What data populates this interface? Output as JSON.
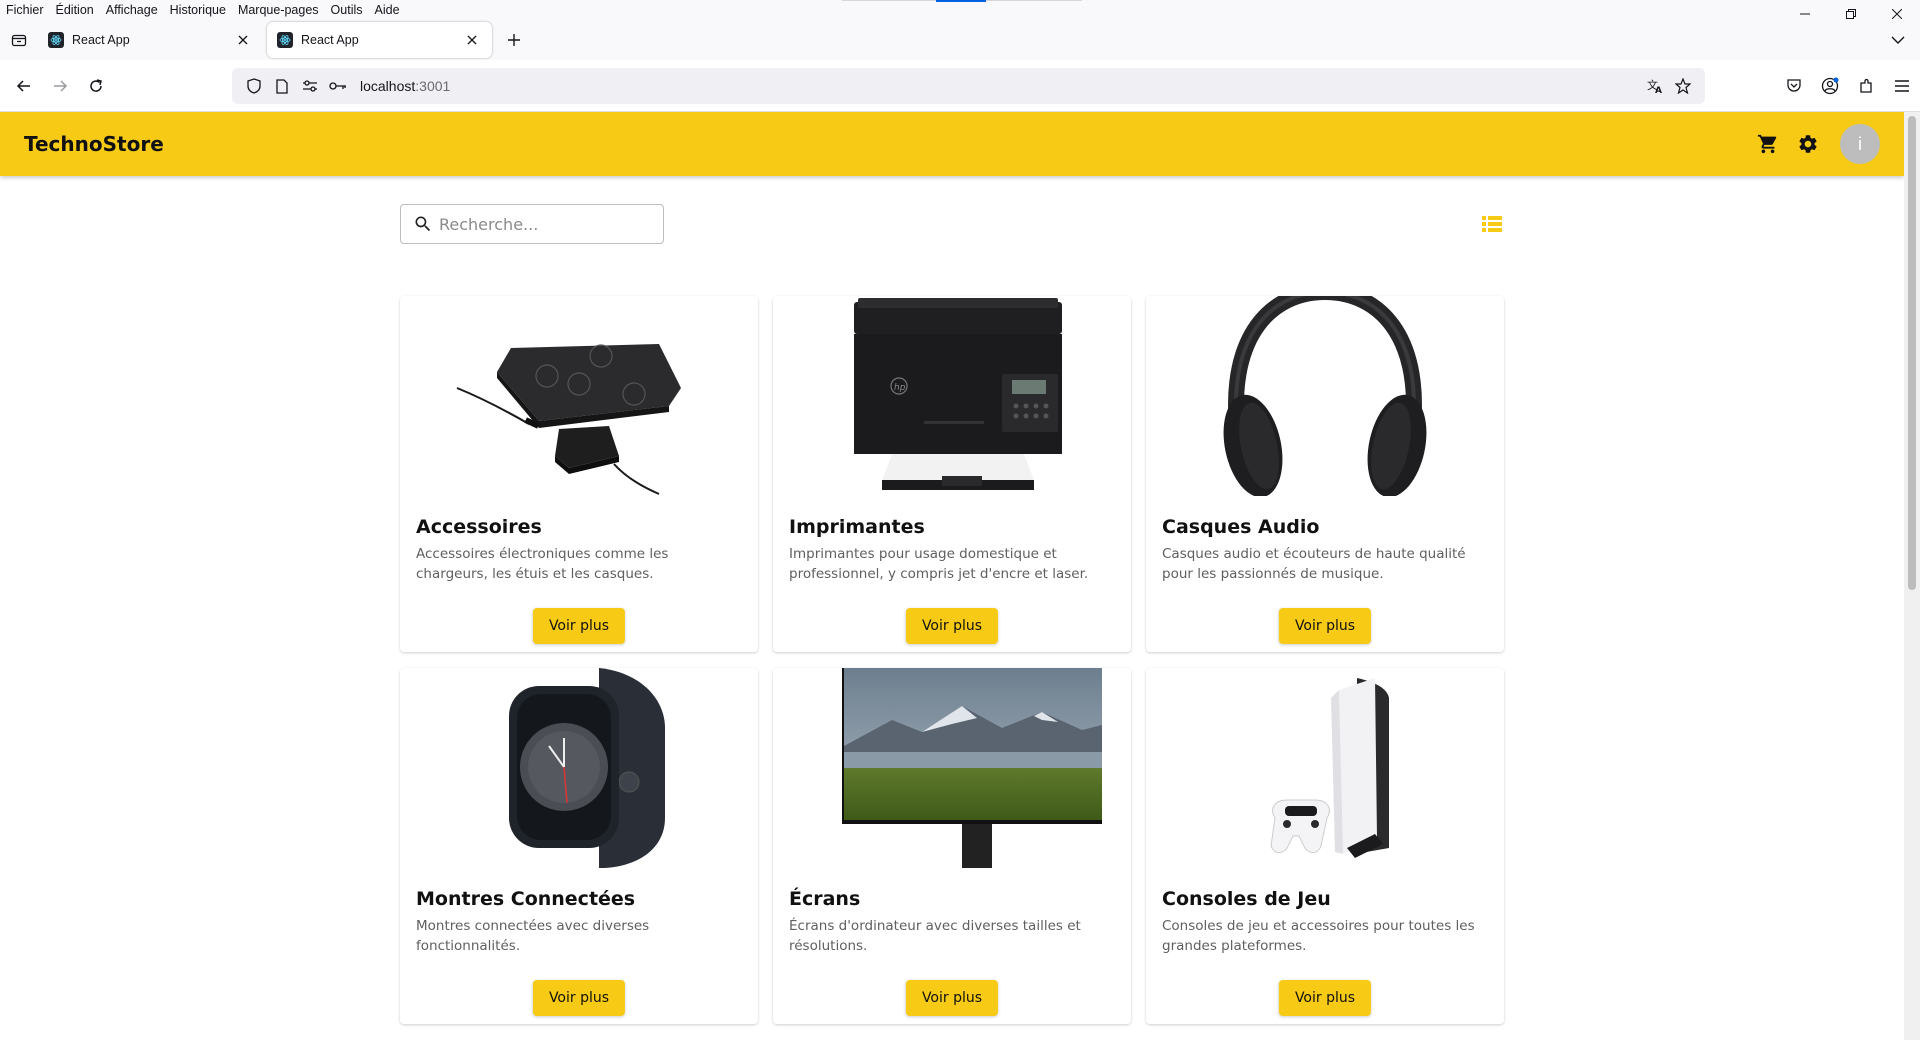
{
  "browser": {
    "menu": [
      "Fichier",
      "Édition",
      "Affichage",
      "Historique",
      "Marque-pages",
      "Outils",
      "Aide"
    ],
    "tabs": [
      {
        "title": "React App",
        "active": false
      },
      {
        "title": "React App",
        "active": true
      }
    ],
    "url_host": "localhost",
    "url_port": ":3001",
    "icons": {
      "back": "arrow-left-icon",
      "forward": "arrow-right-icon",
      "reload": "reload-icon",
      "shield": "shield-icon",
      "page": "page-icon",
      "permissions": "permissions-icon",
      "key": "key-icon",
      "translate": "translate-icon",
      "bookmark": "star-icon",
      "pocket": "pocket-icon",
      "account": "account-icon",
      "extensions": "extensions-icon",
      "menu": "hamburger-icon"
    }
  },
  "app": {
    "brand": "TechnoStore",
    "accent": "#f7cb15",
    "avatar_letter": "i",
    "search": {
      "placeholder": "Recherche..."
    },
    "categories": [
      {
        "title": "Accessoires",
        "description": "Accessoires électroniques comme les chargeurs, les étuis et les casques.",
        "button": "Voir plus",
        "image": "wireless-charger"
      },
      {
        "title": "Imprimantes",
        "description": "Imprimantes pour usage domestique et professionnel, y compris jet d'encre et laser.",
        "button": "Voir plus",
        "image": "printer"
      },
      {
        "title": "Casques Audio",
        "description": "Casques audio et écouteurs de haute qualité pour les passionnés de musique.",
        "button": "Voir plus",
        "image": "headphones"
      },
      {
        "title": "Montres Connectées",
        "description": "Montres connectées avec diverses fonctionnalités.",
        "button": "Voir plus",
        "image": "smartwatch"
      },
      {
        "title": "Écrans",
        "description": "Écrans d'ordinateur avec diverses tailles et résolutions.",
        "button": "Voir plus",
        "image": "monitor"
      },
      {
        "title": "Consoles de Jeu",
        "description": "Consoles de jeu et accessoires pour toutes les grandes plateformes.",
        "button": "Voir plus",
        "image": "game-console"
      }
    ]
  }
}
